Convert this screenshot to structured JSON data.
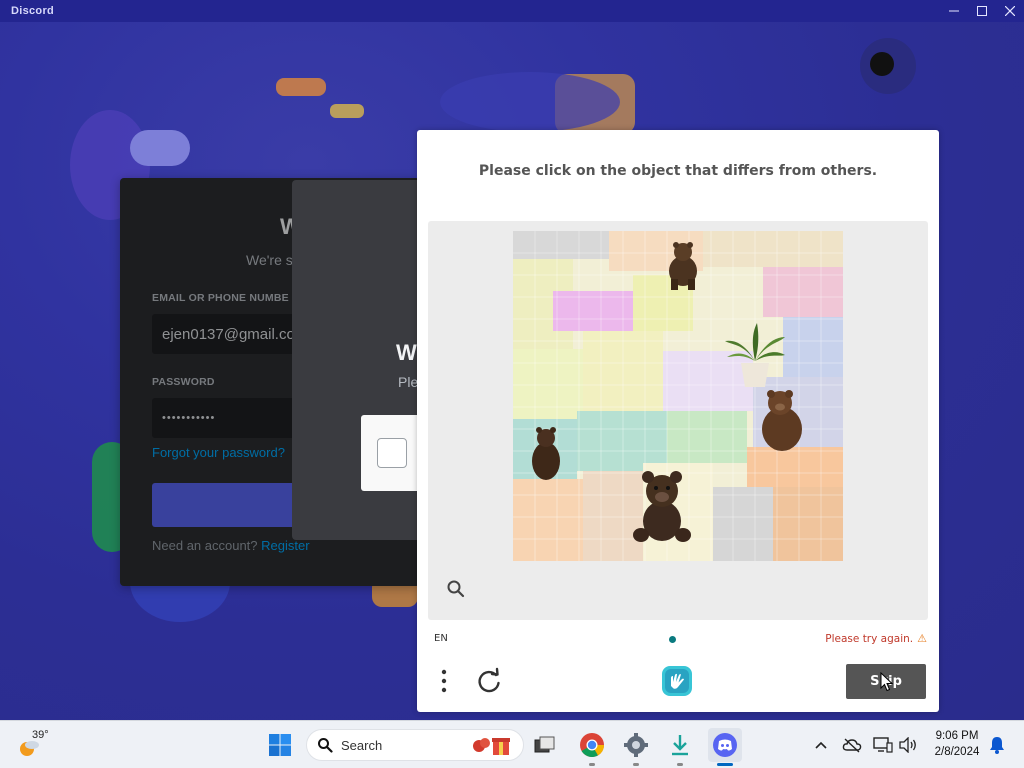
{
  "window": {
    "title": "Discord"
  },
  "login": {
    "welcome": "W",
    "subtitle": "We're s",
    "email_label": "EMAIL OR PHONE NUMBE",
    "email_value": "ejen0137@gmail.co",
    "password_label": "PASSWORD",
    "password_value": "•••••••••••",
    "forgot": "Forgot your password?",
    "need_account": "Need an account? ",
    "register": "Register"
  },
  "bg_modal": {
    "welcome": "W",
    "text": "Ple"
  },
  "captcha": {
    "prompt": "Please click on the object that differs from others.",
    "language": "EN",
    "error": "Please try again.",
    "warn_glyph": "⚠",
    "skip_label": "Skip",
    "objects": [
      {
        "name": "bear",
        "kind": "brown bear"
      },
      {
        "name": "plant",
        "kind": "potted plant"
      },
      {
        "name": "bear",
        "kind": "brown bear"
      },
      {
        "name": "bear",
        "kind": "brown bear"
      },
      {
        "name": "teddy",
        "kind": "teddy bear"
      }
    ]
  },
  "taskbar": {
    "weather_temp": "39°",
    "search_label": "Search",
    "time": "9:06 PM",
    "date": "2/8/2024",
    "apps": [
      "start",
      "search",
      "task-view",
      "chrome",
      "settings",
      "downloads",
      "discord"
    ]
  },
  "colors": {
    "discord_bg": "#2f3190",
    "blurple": "#5865f2",
    "link": "#00a8fc",
    "skip_button": "#555555",
    "error": "#c0392b"
  }
}
